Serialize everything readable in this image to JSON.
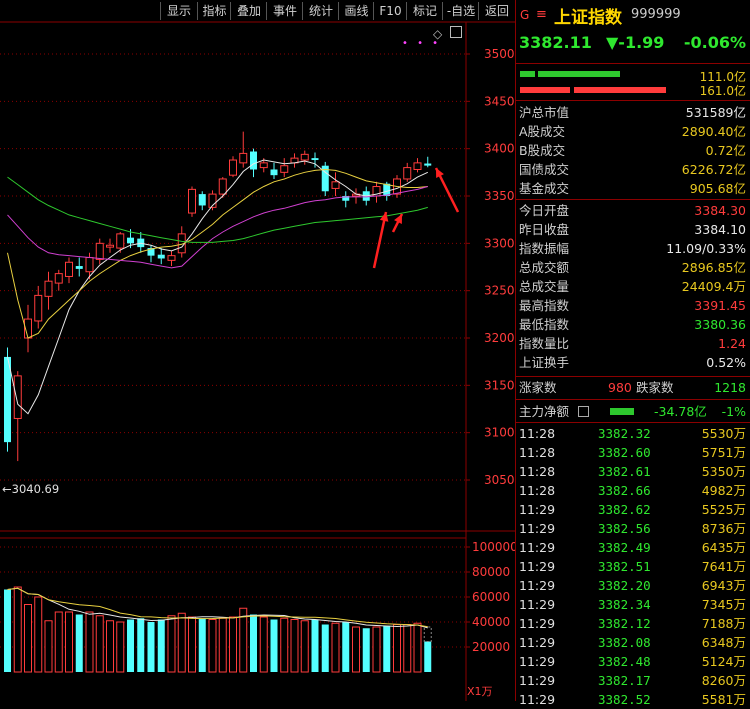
{
  "toolbar": {
    "items": [
      "显示",
      "指标",
      "叠加",
      "事件",
      "统计",
      "画线",
      "F10",
      "标记",
      "-自选",
      "返回"
    ]
  },
  "chart": {
    "min_marker": "←3040.69",
    "price_ticks": [
      "3500",
      "3450",
      "3400",
      "3350",
      "3300",
      "3250",
      "3200",
      "3150",
      "3100",
      "3050"
    ],
    "volume_ticks": [
      "100000",
      "80000",
      "60000",
      "40000",
      "20000"
    ],
    "volume_unit": "X1万"
  },
  "chart_data": {
    "type": "candlestick",
    "price_axis": {
      "min": 3040,
      "max": 3510,
      "ticks": [
        3500,
        3450,
        3400,
        3350,
        3300,
        3250,
        3200,
        3150,
        3100,
        3050
      ]
    },
    "volume_axis": {
      "max": 100000,
      "ticks": [
        100000,
        80000,
        60000,
        40000,
        20000
      ]
    },
    "candles": [
      {
        "o": 3180,
        "c": 3090,
        "h": 3190,
        "l": 3080
      },
      {
        "o": 3115,
        "c": 3160,
        "h": 3165,
        "l": 3070
      },
      {
        "o": 3200,
        "c": 3220,
        "h": 3235,
        "l": 3185
      },
      {
        "o": 3218,
        "c": 3245,
        "h": 3255,
        "l": 3210
      },
      {
        "o": 3244,
        "c": 3260,
        "h": 3270,
        "l": 3230
      },
      {
        "o": 3258,
        "c": 3268,
        "h": 3272,
        "l": 3250
      },
      {
        "o": 3265,
        "c": 3280,
        "h": 3285,
        "l": 3258
      },
      {
        "o": 3276,
        "c": 3273,
        "h": 3285,
        "l": 3265
      },
      {
        "o": 3270,
        "c": 3285,
        "h": 3290,
        "l": 3262
      },
      {
        "o": 3283,
        "c": 3300,
        "h": 3305,
        "l": 3278
      },
      {
        "o": 3296,
        "c": 3298,
        "h": 3305,
        "l": 3290
      },
      {
        "o": 3295,
        "c": 3310,
        "h": 3312,
        "l": 3290
      },
      {
        "o": 3306,
        "c": 3300,
        "h": 3315,
        "l": 3295
      },
      {
        "o": 3305,
        "c": 3296,
        "h": 3312,
        "l": 3290
      },
      {
        "o": 3295,
        "c": 3287,
        "h": 3298,
        "l": 3280
      },
      {
        "o": 3288,
        "c": 3284,
        "h": 3295,
        "l": 3278
      },
      {
        "o": 3282,
        "c": 3287,
        "h": 3292,
        "l": 3276
      },
      {
        "o": 3290,
        "c": 3310,
        "h": 3318,
        "l": 3285
      },
      {
        "o": 3332,
        "c": 3357,
        "h": 3360,
        "l": 3328
      },
      {
        "o": 3352,
        "c": 3340,
        "h": 3355,
        "l": 3335
      },
      {
        "o": 3338,
        "c": 3352,
        "h": 3356,
        "l": 3335
      },
      {
        "o": 3352,
        "c": 3368,
        "h": 3370,
        "l": 3348
      },
      {
        "o": 3372,
        "c": 3388,
        "h": 3392,
        "l": 3370
      },
      {
        "o": 3385,
        "c": 3395,
        "h": 3418,
        "l": 3380
      },
      {
        "o": 3397,
        "c": 3378,
        "h": 3400,
        "l": 3370
      },
      {
        "o": 3380,
        "c": 3385,
        "h": 3390,
        "l": 3375
      },
      {
        "o": 3378,
        "c": 3372,
        "h": 3385,
        "l": 3368
      },
      {
        "o": 3375,
        "c": 3382,
        "h": 3390,
        "l": 3370
      },
      {
        "o": 3385,
        "c": 3390,
        "h": 3395,
        "l": 3380
      },
      {
        "o": 3388,
        "c": 3394,
        "h": 3398,
        "l": 3383
      },
      {
        "o": 3390,
        "c": 3388,
        "h": 3396,
        "l": 3380
      },
      {
        "o": 3382,
        "c": 3355,
        "h": 3386,
        "l": 3350
      },
      {
        "o": 3358,
        "c": 3365,
        "h": 3375,
        "l": 3350
      },
      {
        "o": 3350,
        "c": 3345,
        "h": 3355,
        "l": 3338
      },
      {
        "o": 3350,
        "c": 3352,
        "h": 3358,
        "l": 3342
      },
      {
        "o": 3355,
        "c": 3345,
        "h": 3360,
        "l": 3340
      },
      {
        "o": 3350,
        "c": 3360,
        "h": 3365,
        "l": 3343
      },
      {
        "o": 3363,
        "c": 3350,
        "h": 3365,
        "l": 3345
      },
      {
        "o": 3352,
        "c": 3368,
        "h": 3372,
        "l": 3348
      },
      {
        "o": 3368,
        "c": 3380,
        "h": 3385,
        "l": 3365
      },
      {
        "o": 3378,
        "c": 3385,
        "h": 3390,
        "l": 3375
      },
      {
        "o": 3384.3,
        "c": 3382.11,
        "h": 3391.45,
        "l": 3380.36
      }
    ],
    "volumes": [
      66000,
      68000,
      54000,
      60000,
      41000,
      48000,
      48000,
      46000,
      48000,
      45000,
      41000,
      40000,
      42000,
      43000,
      40000,
      42000,
      45000,
      47000,
      44000,
      43000,
      42000,
      43000,
      44000,
      51000,
      46000,
      44000,
      42000,
      43000,
      42000,
      41000,
      42000,
      38000,
      39000,
      40000,
      36000,
      35000,
      36000,
      37000,
      38000,
      38000,
      39000,
      24409
    ],
    "ma_lines": [
      {
        "color": "#e8e8e8",
        "values": [
          3180,
          3130,
          3120,
          3140,
          3170,
          3200,
          3230,
          3250,
          3265,
          3277,
          3285,
          3293,
          3298,
          3300,
          3298,
          3294,
          3292,
          3296,
          3310,
          3326,
          3340,
          3350,
          3362,
          3376,
          3384,
          3388,
          3386,
          3384,
          3385,
          3387,
          3384,
          3375,
          3367,
          3360,
          3352,
          3350,
          3352,
          3355,
          3358,
          3363,
          3370,
          3375
        ]
      },
      {
        "color": "#e8d040",
        "values": [
          3290,
          3240,
          3200,
          3205,
          3220,
          3230,
          3240,
          3250,
          3260,
          3268,
          3275,
          3282,
          3287,
          3291,
          3294,
          3296,
          3297,
          3299,
          3304,
          3312,
          3320,
          3330,
          3338,
          3346,
          3354,
          3360,
          3365,
          3368,
          3372,
          3375,
          3377,
          3378,
          3377,
          3374,
          3370,
          3366,
          3364,
          3362,
          3360,
          3359,
          3359,
          3360
        ]
      },
      {
        "color": "#d040d0",
        "values": [
          3330,
          3318,
          3306,
          3296,
          3290,
          3288,
          3287,
          3286,
          3285,
          3284,
          3283,
          3282,
          3281,
          3280,
          3278,
          3276,
          3274,
          3276,
          3286,
          3296,
          3305,
          3312,
          3318,
          3323,
          3328,
          3332,
          3335,
          3337,
          3340,
          3343,
          3345,
          3346,
          3348,
          3349,
          3349,
          3349,
          3350,
          3351,
          3353,
          3355,
          3357,
          3360
        ]
      },
      {
        "color": "#2ec82e",
        "values": [
          3370,
          3362,
          3354,
          3346,
          3340,
          3335,
          3330,
          3327,
          3324,
          3321,
          3318,
          3315,
          3312,
          3310,
          3308,
          3306,
          3304,
          3302,
          3301,
          3301,
          3301,
          3302,
          3303,
          3305,
          3308,
          3311,
          3314,
          3316,
          3318,
          3320,
          3322,
          3323,
          3324,
          3325,
          3326,
          3327,
          3328,
          3329,
          3331,
          3333,
          3335,
          3338
        ]
      }
    ]
  },
  "quote": {
    "flag_icon": "G",
    "menu_icon": "≡",
    "name": "上证指数",
    "code": "999999",
    "price": "3382.11",
    "change": "▼-1.99",
    "pct": "-0.06%",
    "bar1_value": "111.0亿",
    "bar2_value": "161.0亿",
    "stats": [
      {
        "label": "沪总市值",
        "value": "531589亿",
        "color": "wht"
      },
      {
        "label": "A股成交",
        "value": "2890.40亿",
        "color": "yel"
      },
      {
        "label": "B股成交",
        "value": "0.72亿",
        "color": "yel"
      },
      {
        "label": "国债成交",
        "value": "6226.72亿",
        "color": "yel"
      },
      {
        "label": "基金成交",
        "value": "905.68亿",
        "color": "yel"
      },
      {
        "label": "今日开盘",
        "value": "3384.30",
        "color": "red"
      },
      {
        "label": "昨日收盘",
        "value": "3384.10",
        "color": "wht"
      },
      {
        "label": "指数振幅",
        "value": "11.09/0.33%",
        "color": "wht"
      },
      {
        "label": "总成交额",
        "value": "2896.85亿",
        "color": "yel"
      },
      {
        "label": "总成交量",
        "value": "24409.4万",
        "color": "yel"
      },
      {
        "label": "最高指数",
        "value": "3391.45",
        "color": "red"
      },
      {
        "label": "最低指数",
        "value": "3380.36",
        "color": "grn"
      },
      {
        "label": "指数量比",
        "value": "1.24",
        "color": "red"
      },
      {
        "label": "上证换手",
        "value": "0.52%",
        "color": "wht"
      }
    ],
    "rise_label": "涨家数",
    "rise_count": "980",
    "fall_label": "跌家数",
    "fall_count": "1218",
    "capital_label": "主力净额",
    "capital_value": "-34.78亿",
    "capital_pct": "-1%",
    "ticks": [
      {
        "time": "11:28",
        "price": "3382.32",
        "vol": "5530万"
      },
      {
        "time": "11:28",
        "price": "3382.60",
        "vol": "5751万"
      },
      {
        "time": "11:28",
        "price": "3382.61",
        "vol": "5350万"
      },
      {
        "time": "11:28",
        "price": "3382.66",
        "vol": "4982万"
      },
      {
        "time": "11:29",
        "price": "3382.62",
        "vol": "5525万"
      },
      {
        "time": "11:29",
        "price": "3382.56",
        "vol": "8736万"
      },
      {
        "time": "11:29",
        "price": "3382.49",
        "vol": "6435万"
      },
      {
        "time": "11:29",
        "price": "3382.51",
        "vol": "7641万"
      },
      {
        "time": "11:29",
        "price": "3382.20",
        "vol": "6943万"
      },
      {
        "time": "11:29",
        "price": "3382.34",
        "vol": "7345万"
      },
      {
        "time": "11:29",
        "price": "3382.12",
        "vol": "7188万"
      },
      {
        "time": "11:29",
        "price": "3382.08",
        "vol": "6348万"
      },
      {
        "time": "11:29",
        "price": "3382.48",
        "vol": "5124万"
      },
      {
        "time": "11:29",
        "price": "3382.17",
        "vol": "8260万"
      },
      {
        "time": "11:29",
        "price": "3382.52",
        "vol": "5581万"
      }
    ]
  },
  "colors": {
    "up": "#ff3c3c",
    "down": "#54ffff",
    "grid": "#8b0000"
  }
}
